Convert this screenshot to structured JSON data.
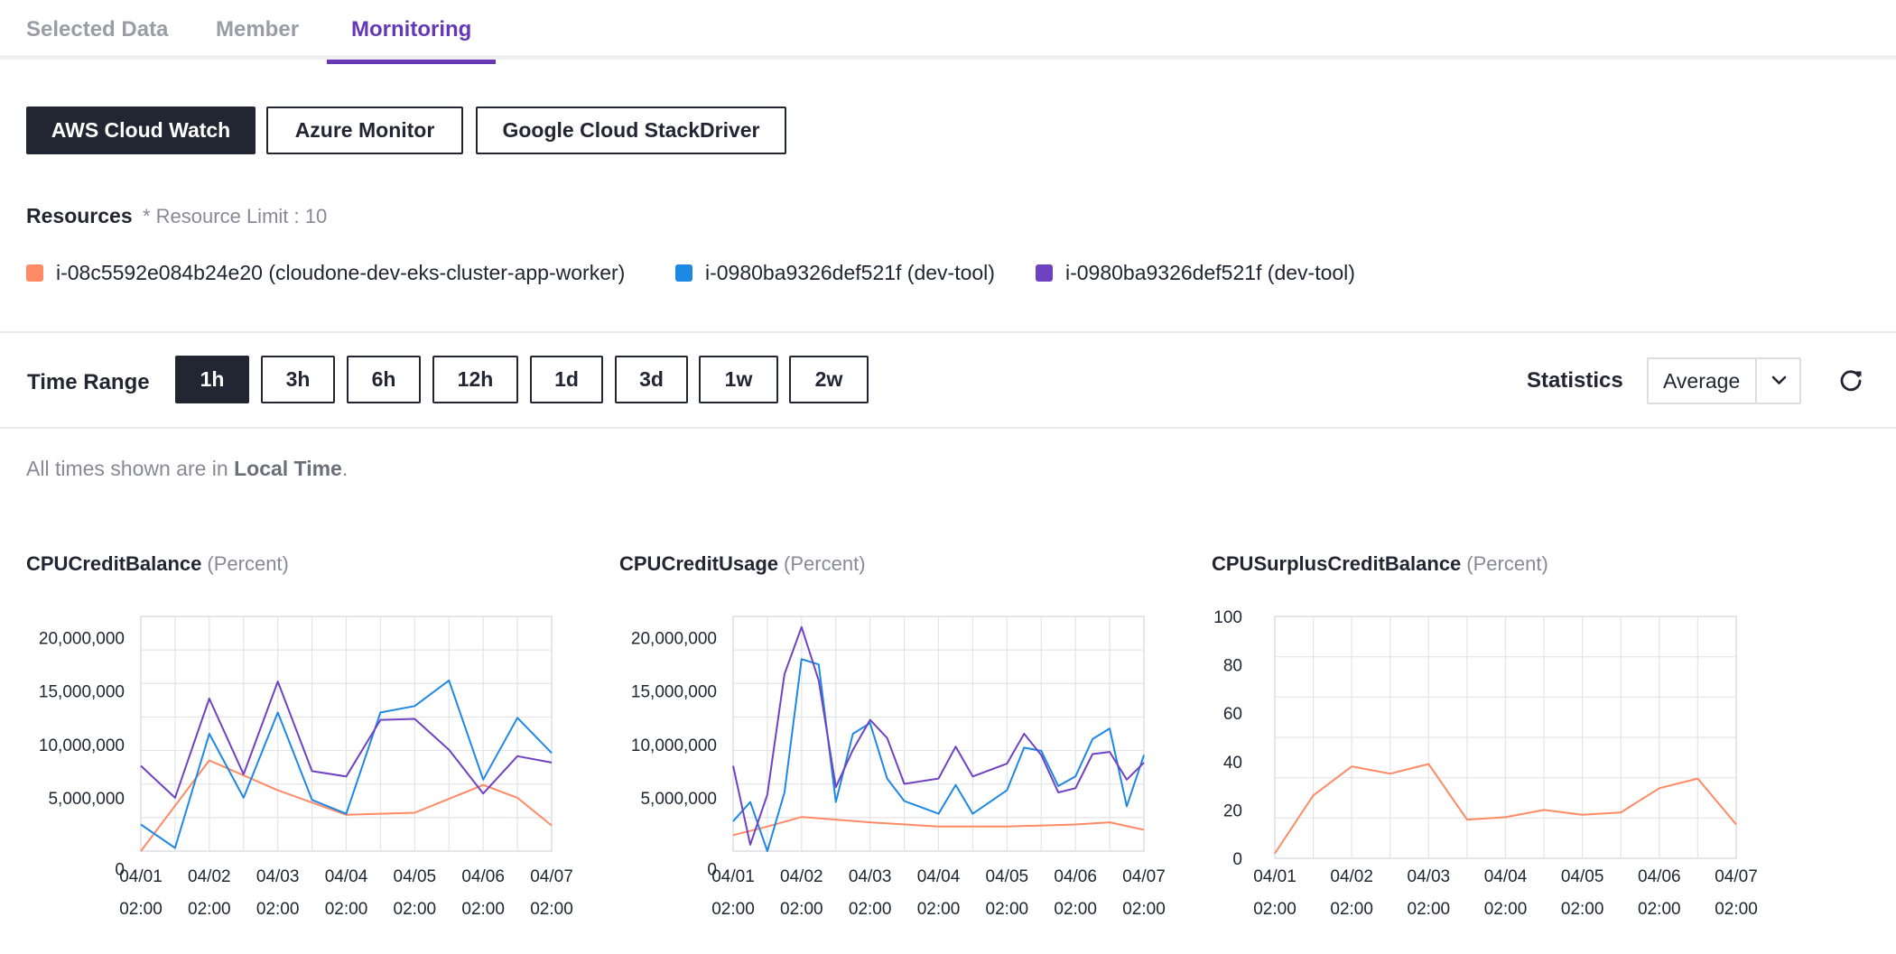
{
  "tabs": [
    {
      "label": "Selected Data",
      "active": false
    },
    {
      "label": "Member",
      "active": false
    },
    {
      "label": "Mornitoring",
      "active": true
    }
  ],
  "providers": [
    {
      "label": "AWS Cloud Watch",
      "active": true
    },
    {
      "label": "Azure Monitor",
      "active": false
    },
    {
      "label": "Google Cloud StackDriver",
      "active": false
    }
  ],
  "resources": {
    "title": "Resources",
    "limit": "* Resource Limit : 10",
    "items": [
      {
        "label": "i-08c5592e084b24e20 (cloudone-dev-eks-cluster-app-worker)",
        "color": "#ff8a65"
      },
      {
        "label": "i-0980ba9326def521f (dev-tool)",
        "color": "#1e88e5"
      },
      {
        "label": "i-0980ba9326def521f (dev-tool)",
        "color": "#6f42c1"
      }
    ]
  },
  "time_range": {
    "label": "Time Range",
    "options": [
      "1h",
      "3h",
      "6h",
      "12h",
      "1d",
      "3d",
      "1w",
      "2w"
    ],
    "selected": "1h"
  },
  "statistics": {
    "label": "Statistics",
    "value": "Average",
    "chevron_icon": "chevron-down-icon",
    "refresh_icon": "refresh-icon"
  },
  "note": {
    "prefix": "All times shown are in ",
    "emphasis": "Local Time",
    "suffix": "."
  },
  "chart_data": [
    {
      "type": "line",
      "title": "CPUCreditBalance",
      "unit": "(Percent)",
      "x_ticks": [
        [
          "04/01",
          "02:00"
        ],
        [
          "04/02",
          "02:00"
        ],
        [
          "04/03",
          "02:00"
        ],
        [
          "04/04",
          "02:00"
        ],
        [
          "04/05",
          "02:00"
        ],
        [
          "04/06",
          "02:00"
        ],
        [
          "04/07",
          "02:00"
        ]
      ],
      "y_ticks": [
        "20,000,000",
        "15,000,000",
        "10,000,000",
        "5,000,000",
        "0"
      ],
      "ylim": [
        0,
        22000000
      ],
      "series": [
        {
          "color": "#ff8a65",
          "x": [
            0,
            1,
            2,
            3,
            4,
            5,
            5.5,
            6
          ],
          "y": [
            0,
            8500000,
            5700000,
            3400000,
            3600000,
            6200000,
            5000000,
            2400000
          ]
        },
        {
          "color": "#1e88e5",
          "x": [
            0,
            0.5,
            1,
            1.5,
            2,
            2.5,
            3,
            3.5,
            4,
            4.5,
            5,
            5.5,
            6
          ],
          "y": [
            2500000,
            300000,
            11000000,
            5000000,
            13000000,
            4800000,
            3500000,
            13000000,
            13600000,
            16000000,
            6700000,
            12500000,
            9200000
          ]
        },
        {
          "color": "#6f42c1",
          "x": [
            0,
            0.5,
            1,
            1.5,
            2,
            2.5,
            3,
            3.5,
            4,
            4.5,
            5,
            5.5,
            6
          ],
          "y": [
            8000000,
            5000000,
            14300000,
            7200000,
            15900000,
            7500000,
            7000000,
            12300000,
            12400000,
            9500000,
            5400000,
            8900000,
            8300000
          ]
        }
      ]
    },
    {
      "type": "line",
      "title": "CPUCreditUsage",
      "unit": "(Percent)",
      "x_ticks": [
        [
          "04/01",
          "02:00"
        ],
        [
          "04/02",
          "02:00"
        ],
        [
          "04/03",
          "02:00"
        ],
        [
          "04/04",
          "02:00"
        ],
        [
          "04/05",
          "02:00"
        ],
        [
          "04/06",
          "02:00"
        ],
        [
          "04/07",
          "02:00"
        ]
      ],
      "y_ticks": [
        "20,000,000",
        "15,000,000",
        "10,000,000",
        "5,000,000",
        "0"
      ],
      "ylim": [
        0,
        22000000
      ],
      "series": [
        {
          "color": "#ff8a65",
          "x": [
            0,
            0.5,
            1,
            2,
            3,
            4,
            5,
            5.5,
            6
          ],
          "y": [
            1500000,
            2300000,
            3200000,
            2700000,
            2300000,
            2300000,
            2500000,
            2700000,
            2000000
          ]
        },
        {
          "color": "#1e88e5",
          "x": [
            0,
            0.25,
            0.5,
            0.75,
            1,
            1.25,
            1.5,
            1.75,
            2,
            2.25,
            2.5,
            3,
            3.25,
            3.5,
            4,
            4.25,
            4.5,
            4.75,
            5,
            5.25,
            5.5,
            5.75,
            6
          ],
          "y": [
            2800000,
            4600000,
            0,
            5500000,
            18000000,
            17500000,
            4600000,
            11000000,
            12000000,
            6800000,
            4700000,
            3500000,
            6200000,
            3500000,
            5700000,
            9700000,
            9400000,
            6100000,
            7000000,
            10500000,
            11500000,
            4200000,
            9000000
          ]
        },
        {
          "color": "#6f42c1",
          "x": [
            0,
            0.25,
            0.5,
            0.75,
            1,
            1.25,
            1.5,
            1.75,
            2,
            2.25,
            2.5,
            3,
            3.25,
            3.5,
            4,
            4.25,
            4.5,
            4.75,
            5,
            5.25,
            5.5,
            5.75,
            6
          ],
          "y": [
            8000000,
            600000,
            5300000,
            16600000,
            21000000,
            16000000,
            6000000,
            9500000,
            12300000,
            10600000,
            6300000,
            6800000,
            9800000,
            7000000,
            8200000,
            11000000,
            9000000,
            5500000,
            5900000,
            9100000,
            9300000,
            6700000,
            8300000
          ]
        }
      ]
    },
    {
      "type": "line",
      "title": "CPUSurplusCreditBalance",
      "unit": "(Percent)",
      "x_ticks": [
        [
          "04/01",
          "02:00"
        ],
        [
          "04/02",
          "02:00"
        ],
        [
          "04/03",
          "02:00"
        ],
        [
          "04/04",
          "02:00"
        ],
        [
          "04/05",
          "02:00"
        ],
        [
          "04/06",
          "02:00"
        ],
        [
          "04/07",
          "02:00"
        ]
      ],
      "y_ticks": [
        "100",
        "80",
        "60",
        "40",
        "20",
        "0"
      ],
      "ylim": [
        0,
        100
      ],
      "series": [
        {
          "color": "#ff8a65",
          "x": [
            0,
            0.5,
            1,
            1.5,
            2,
            2.5,
            3,
            3.5,
            4,
            4.5,
            5,
            5.5,
            6
          ],
          "y": [
            2,
            26,
            38,
            35,
            39,
            16,
            17,
            20,
            18,
            19,
            29,
            33,
            14
          ]
        }
      ]
    }
  ]
}
